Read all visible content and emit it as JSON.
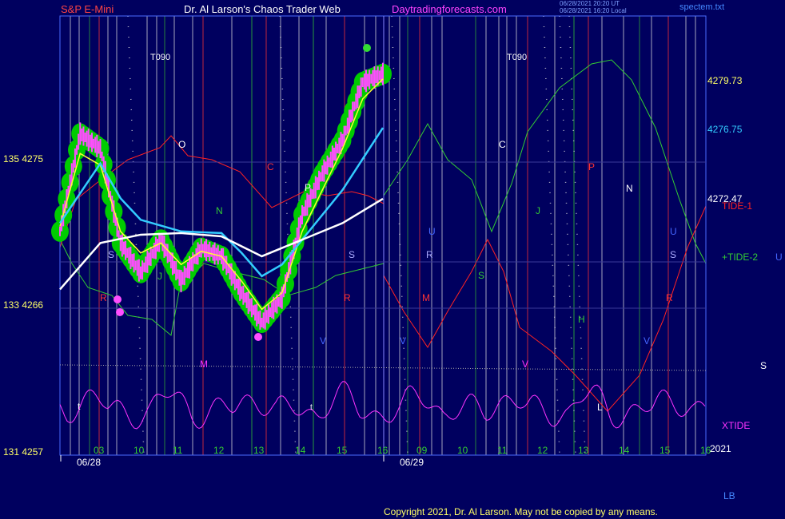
{
  "header": {
    "instrument": "S&P E-Mini",
    "site_title": "Dr. Al Larson's Chaos Trader Web",
    "site_url": "Daytradingforecasts.com",
    "timestamp_1": "06/28/2021 20:20 UT",
    "timestamp_2": "06/28/2021 16:20 Local",
    "file_name": "spectem.txt"
  },
  "footer": {
    "copyright": "Copyright 2021, Dr. Al Larson. May not be copied by any means.",
    "lb": "LB"
  },
  "colors": {
    "background": "#00005f",
    "frame": "#4a6cff",
    "price_bars": "#ff4dff",
    "yellow_avg": "#ffff33",
    "cyan_avg": "#33ccff",
    "white_avg": "#ffffff",
    "green_envelope": "#00cc00",
    "tide1": "#ff2222",
    "tide2": "#33cc33",
    "xtide": "#ff33ff"
  },
  "chart_data": {
    "type": "line",
    "title": "S&P E-Mini",
    "y_right_labels": [
      {
        "label": "4279.73",
        "value": 4279.73,
        "color": "#ffff66"
      },
      {
        "label": "4276.75",
        "value": 4276.75,
        "color": "#33ccff"
      },
      {
        "label": "4272.47",
        "value": 4272.47,
        "color": "#ffffff"
      }
    ],
    "y_left_labels": [
      {
        "label": "135  4275",
        "value": 4275
      },
      {
        "label": "133  4266",
        "value": 4266
      },
      {
        "label": "131  4257",
        "value": 4257
      }
    ],
    "ylim": [
      4257,
      4283.5
    ],
    "x_hour_ticks": [
      "03",
      "10",
      "11",
      "12",
      "13",
      "14",
      "15",
      "16",
      "09",
      "10",
      "11",
      "12",
      "13",
      "14",
      "15",
      "16"
    ],
    "x_dates": [
      "06/28",
      "06/29"
    ],
    "year_label": "2021",
    "turn_labels": [
      "T090",
      "T090"
    ],
    "legend": [
      {
        "label": "TIDE-1",
        "color": "#ff2222"
      },
      {
        "label": "+TIDE-2",
        "color": "#33cc33"
      },
      {
        "label": "XTIDE",
        "color": "#ff33ff"
      }
    ],
    "legend_extra": [
      "U",
      "S"
    ],
    "planet_markers": [
      "O",
      "C",
      "P",
      "N",
      "J",
      "S",
      "R",
      "M",
      "V",
      "U",
      "H",
      "L",
      "t",
      "C",
      "P",
      "N",
      "J",
      "S",
      "R",
      "M",
      "V",
      "U"
    ],
    "series": [
      {
        "name": "price",
        "x": [
          0,
          0.5,
          1,
          1.5,
          2,
          2.5,
          3,
          3.5,
          4,
          4.5,
          5,
          5.5,
          6,
          6.5,
          7,
          7.5,
          8
        ],
        "values": [
          4270.5,
          4276.4,
          4275.5,
          4269.8,
          4268.0,
          4270.0,
          4267.5,
          4269.5,
          4269.0,
          4266.8,
          4265.0,
          4266.5,
          4271.5,
          4274.0,
          4276.0,
          4279.5,
          4280.0
        ]
      },
      {
        "name": "yellow average",
        "x": [
          0,
          0.5,
          1,
          1.5,
          2,
          2.5,
          3,
          3.5,
          4,
          4.5,
          5,
          5.5,
          6,
          6.5,
          7,
          7.5,
          8
        ],
        "values": [
          4270.8,
          4275.2,
          4274.5,
          4270.5,
          4269.2,
          4269.8,
          4268.5,
          4269.3,
          4269.0,
          4267.5,
          4265.8,
          4266.8,
          4270.5,
          4273.0,
          4275.5,
          4278.5,
          4279.7
        ]
      },
      {
        "name": "cyan average",
        "x": [
          0,
          1,
          1.5,
          2,
          3,
          4,
          4.5,
          5,
          5.5,
          6,
          7,
          8
        ],
        "values": [
          4271.0,
          4274.6,
          4272.5,
          4271.2,
          4270.5,
          4270.4,
          4269.2,
          4267.8,
          4268.5,
          4270.0,
          4273.0,
          4276.75
        ]
      },
      {
        "name": "white average",
        "x": [
          0,
          1,
          2,
          3,
          4,
          5,
          6,
          7,
          8
        ],
        "values": [
          4267.0,
          4269.8,
          4270.3,
          4270.4,
          4270.2,
          4269.0,
          4270.0,
          4271.0,
          4272.47
        ]
      }
    ]
  }
}
